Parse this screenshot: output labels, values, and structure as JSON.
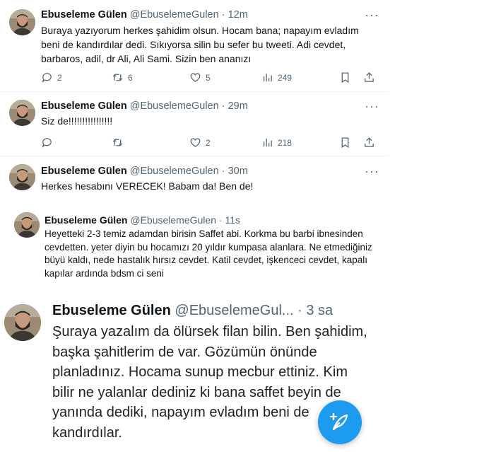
{
  "tweets": [
    {
      "name": "Ebuseleme Gülen",
      "handle": "@EbuselemeGulen",
      "time": "· 12m",
      "text": "Buraya yazıyorum herkes şahidim olsun. Hocam bana; napayım evladım beni de kandırdılar dedi. Sıkıyorsa silin bu sefer bu tweeti. Adi cevdet, barbaros, adil, dr Ali, Ali Sami. Sizin ben ananızı",
      "replies": "2",
      "retweets": "6",
      "likes": "5",
      "views": "249"
    },
    {
      "name": "Ebuseleme Gülen",
      "handle": "@EbuselemeGulen",
      "time": "· 29m",
      "text": "Siz de!!!!!!!!!!!!!!!!",
      "replies": "",
      "retweets": "",
      "likes": "2",
      "views": "218"
    },
    {
      "name": "Ebuseleme Gülen",
      "handle": "@EbuselemeGulen",
      "time": "· 30m",
      "text": "Herkes hesabını VERECEK! Babam da! Ben de!"
    },
    {
      "name": "Ebuseleme Gülen",
      "handle": "@EbuselemeGulen",
      "time": "· 11s",
      "text": "Heyetteki 2-3 temiz adamdan birisin Saffet abi. Korkma bu barbi ibnesinden cevdetten. yeter diyin bu hocamızı 20 yıldır kumpasa alanlara. Ne etmediğiniz büyü kaldı, nede hastalık hırsız cevdet. Katil cevdet, işkenceci cevdet, kapalı kapılar ardında bdsm ci seni"
    },
    {
      "name": "Ebuseleme Gülen",
      "handle": "@EbuselemeGul...",
      "time": "· 3 sa",
      "text": "Şuraya yazalım da ölürsek filan bilin. Ben şahidim, başka şahitlerim de var. Gözümün önünde planladınız. Hocama sunup mecbur ettiniz. Kim bilir ne yalanlar dediniz ki bana saffet beyin de yanında dediki, napayım evladım beni de kandırdılar."
    }
  ],
  "icons": {
    "more": "more-dots-icon",
    "reply": "reply-icon",
    "retweet": "retweet-icon",
    "like": "heart-icon",
    "views": "views-icon",
    "bookmark": "bookmark-icon",
    "share": "share-icon",
    "compose": "compose-feather-icon"
  },
  "colors": {
    "accent": "#1d9bf0",
    "muted": "#536471",
    "text": "#0f1419"
  }
}
